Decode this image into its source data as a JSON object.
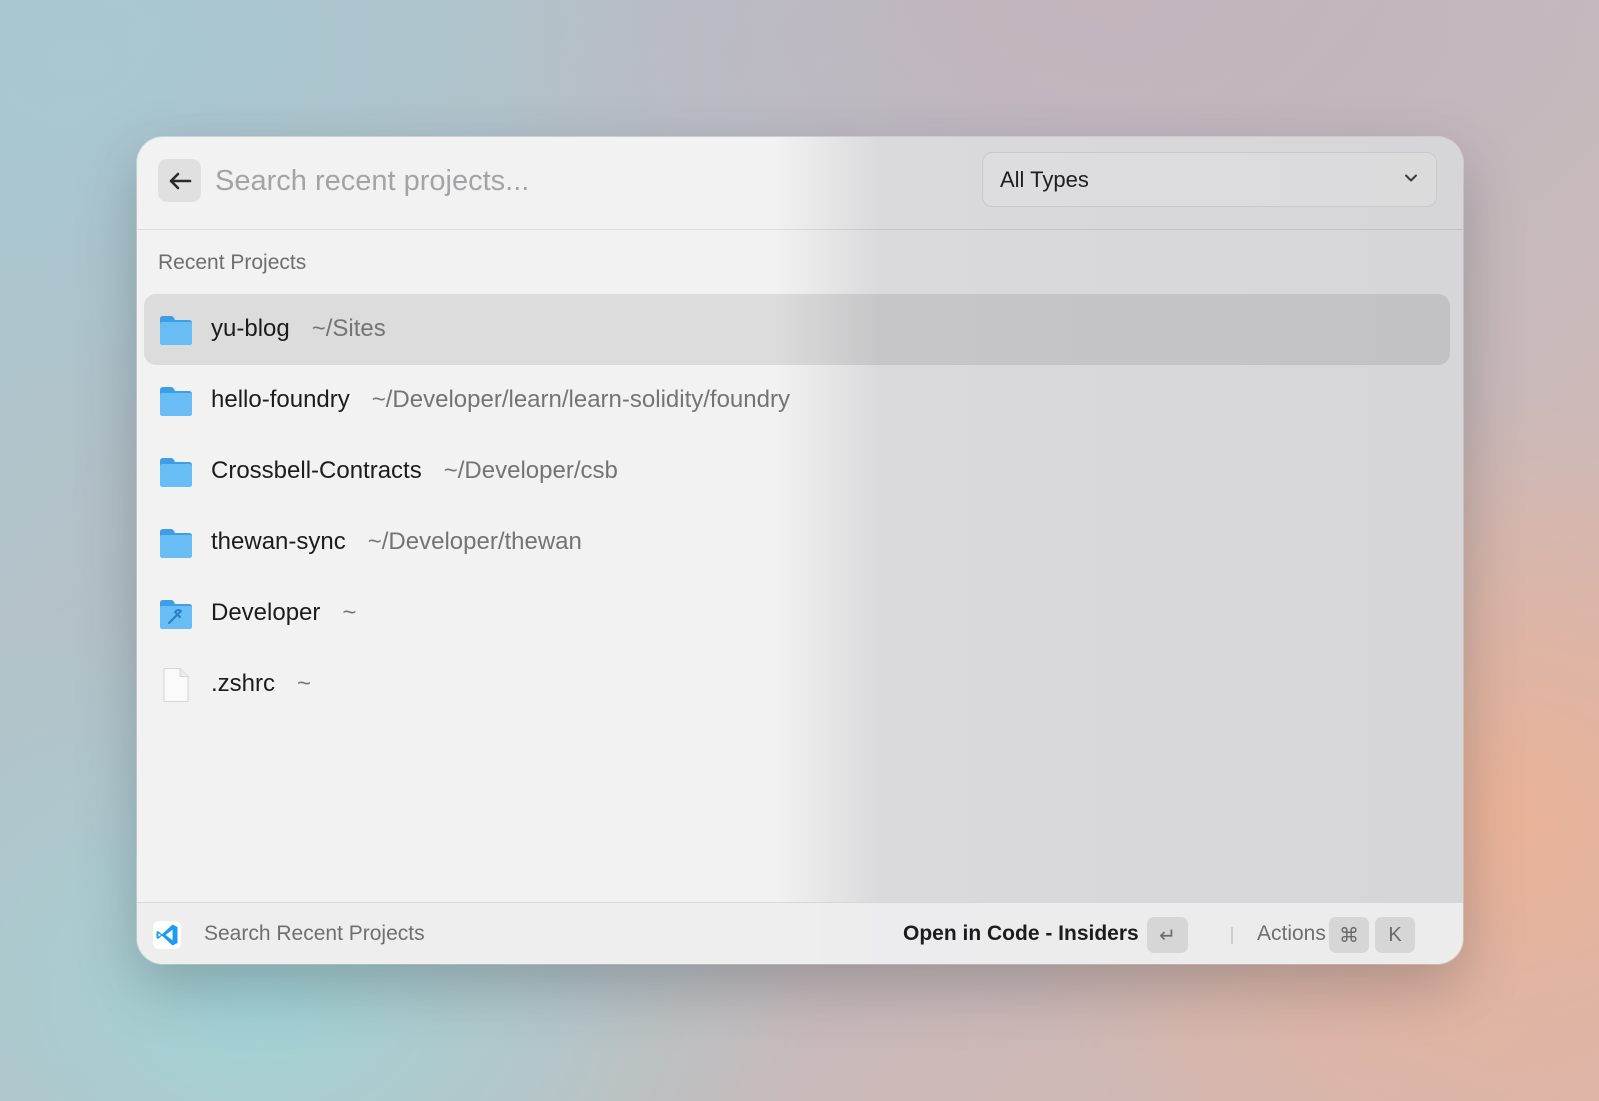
{
  "header": {
    "search_placeholder": "Search recent projects...",
    "filter": {
      "selected": "All Types"
    }
  },
  "section_title": "Recent Projects",
  "projects": [
    {
      "name": "yu-blog",
      "path": "~/Sites",
      "icon": "folder-icon",
      "selected": true
    },
    {
      "name": "hello-foundry",
      "path": "~/Developer/learn/learn-solidity/foundry",
      "icon": "folder-icon",
      "selected": false
    },
    {
      "name": "Crossbell-Contracts",
      "path": "~/Developer/csb",
      "icon": "folder-icon",
      "selected": false
    },
    {
      "name": "thewan-sync",
      "path": "~/Developer/thewan",
      "icon": "folder-icon",
      "selected": false
    },
    {
      "name": "Developer",
      "path": "~",
      "icon": "developer-folder-icon",
      "selected": false
    },
    {
      "name": ".zshrc",
      "path": "~",
      "icon": "file-icon",
      "selected": false
    }
  ],
  "footer": {
    "app_icon": "vscode-insiders-icon",
    "title": "Search Recent Projects",
    "primary_action": "Open in Code - Insiders",
    "primary_shortcut": "↵",
    "actions_label": "Actions",
    "actions_shortcut": [
      "⌘",
      "K"
    ]
  },
  "colors": {
    "folder_blue": "#5eb3f0",
    "vscode_blue": "#1f9cf0",
    "selection_bg": "#d9d9dc"
  }
}
